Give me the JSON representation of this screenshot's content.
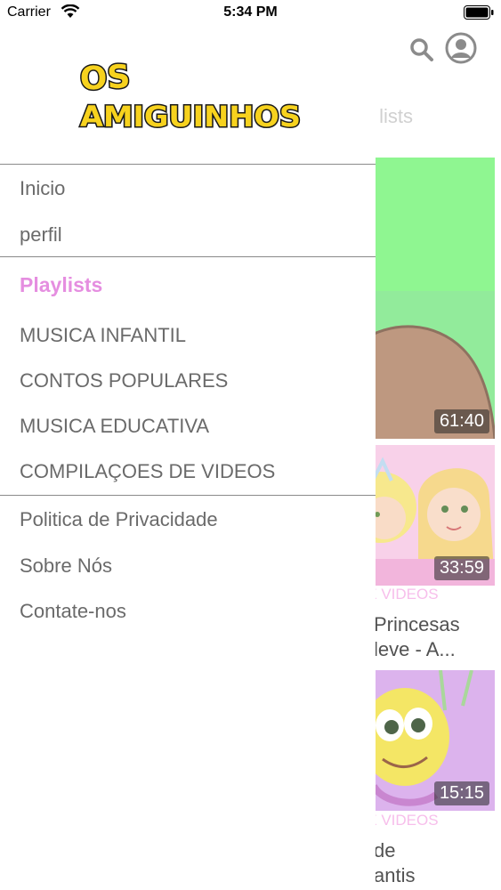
{
  "status_bar": {
    "carrier": "Carrier",
    "time": "5:34 PM"
  },
  "background": {
    "tab_label": "lists",
    "cards": [
      {
        "duration": "61:40"
      },
      {
        "duration": "33:59",
        "category": "DE VIDEOS",
        "title_line1": "Princesas",
        "title_line2": "leve -  A..."
      },
      {
        "duration": "15:15",
        "category": "DE VIDEOS",
        "title_line1": "de",
        "title_line2": "antis"
      }
    ]
  },
  "drawer": {
    "logo_text_top": "OS",
    "logo_text_bottom": "AMIGUINHOS",
    "primary_items": [
      {
        "label": "Inicio"
      },
      {
        "label": "perfil"
      }
    ],
    "playlists_header": "Playlists",
    "playlist_items": [
      {
        "label": "MUSICA INFANTIL"
      },
      {
        "label": "CONTOS POPULARES"
      },
      {
        "label": "MUSICA EDUCATIVA"
      },
      {
        "label": "COMPILAÇOES DE VIDEOS"
      }
    ],
    "footer_items": [
      {
        "label": "Politica de Privacidade"
      },
      {
        "label": "Sobre Nós"
      },
      {
        "label": "Contate-nos"
      }
    ]
  },
  "colors": {
    "accent_pink": "#e58ee0",
    "menu_text": "#6a6a6a",
    "thumb_green": "#7cf57e",
    "logo_yellow": "#f7d21e"
  }
}
